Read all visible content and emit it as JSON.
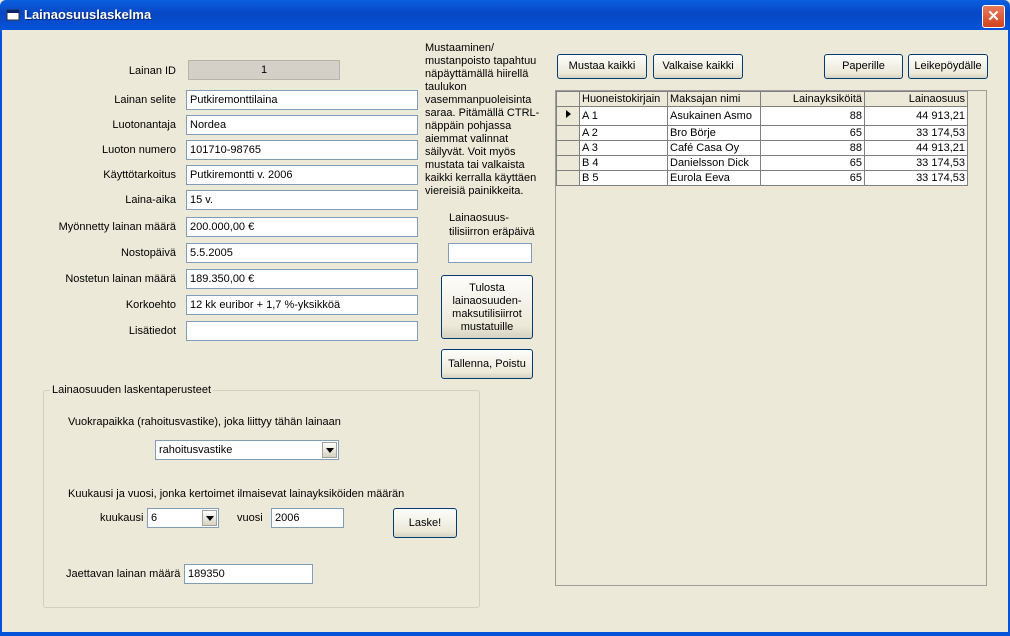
{
  "window": {
    "title": "Lainaosuuslaskelma",
    "close": "✕"
  },
  "form": {
    "lainan_id": {
      "label": "Lainan ID",
      "value": "1"
    },
    "lainan_selite": {
      "label": "Lainan selite",
      "value": "Putkiremonttilaina"
    },
    "luotonantaja": {
      "label": "Luotonantaja",
      "value": "Nordea"
    },
    "luoton_numero": {
      "label": "Luoton numero",
      "value": "101710-98765"
    },
    "kayttotarkoitus": {
      "label": "Käyttötarkoitus",
      "value": "Putkiremontti v. 2006"
    },
    "laina_aika": {
      "label": "Laina-aika",
      "value": "15 v."
    },
    "myonnetty": {
      "label": "Myönnetty lainan määrä",
      "value": "200.000,00 €"
    },
    "nostopaiva": {
      "label": "Nostopäivä",
      "value": "5.5.2005"
    },
    "nostettu": {
      "label": "Nostetun lainan määrä",
      "value": "189.350,00 €"
    },
    "korkoehto": {
      "label": "Korkoehto",
      "value": "12 kk euribor + 1,7 %-yksikköä"
    },
    "lisatiedot": {
      "label": "Lisätiedot",
      "value": ""
    }
  },
  "help_text": "Mustaaminen/ mustanpoisto tapahtuu näpäyttämällä hiirellä taulukon vasemmanpuoleisinta saraa. Pitämällä CTRL-näppäin pohjassa aiemmat valinnat säilyvät. Voit myös mustata tai valkaista kaikki kerralla käyttäen viereisiä painikkeita.",
  "due_date": {
    "label": "Lainaosuus- tilisiirron eräpäivä",
    "value": ""
  },
  "buttons": {
    "print_transfers": "Tulosta lainaosuuden- maksutilisiirrot mustatuille",
    "save_close": "Tallenna, Poistu",
    "blacken_all": "Mustaa kaikki",
    "whiten_all": "Valkaise kaikki",
    "to_paper": "Paperille",
    "to_clipboard": "Leikepöydälle",
    "calculate": "Laske!"
  },
  "group": {
    "title": "Lainaosuuden laskentaperusteet",
    "rent_label": "Vuokrapaikka (rahoitusvastike), joka liittyy tähän lainaan",
    "rent_value": "rahoitusvastike",
    "month_year_label": "Kuukausi ja vuosi, jonka kertoimet ilmaisevat lainayksiköiden määrän",
    "month_label": "kuukausi",
    "month_value": "6",
    "year_label": "vuosi",
    "year_value": "2006",
    "amount_label": "Jaettavan lainan määrä",
    "amount_value": "189350"
  },
  "table": {
    "columns": [
      "Huoneistokirjain",
      "Maksajan nimi",
      "Lainayksiköitä",
      "Lainaosuus"
    ],
    "rows": [
      [
        "A 1",
        "Asukainen Asmo",
        "88",
        "44 913,21"
      ],
      [
        "A 2",
        "Bro Börje",
        "65",
        "33 174,53"
      ],
      [
        "A 3",
        "Café Casa Oy",
        "88",
        "44 913,21"
      ],
      [
        "B 4",
        "Danielsson Dick",
        "65",
        "33 174,53"
      ],
      [
        "B 5",
        "Eurola Eeva",
        "65",
        "33 174,53"
      ]
    ]
  },
  "colors": {
    "titlebar": "#0553d8",
    "background": "#ece9d8"
  }
}
